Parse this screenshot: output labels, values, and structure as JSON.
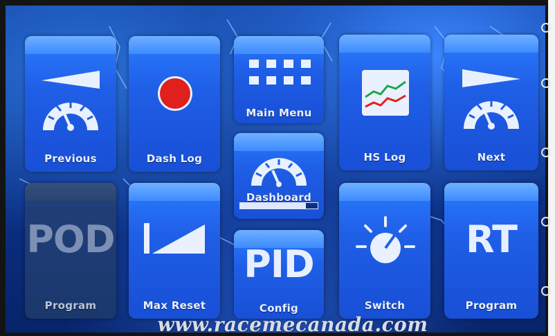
{
  "tiles": {
    "previous": {
      "label": "Previous"
    },
    "dash_log": {
      "label": "Dash Log"
    },
    "main_menu": {
      "label": "Main Menu"
    },
    "hs_log": {
      "label": "HS Log"
    },
    "next": {
      "label": "Next"
    },
    "pod_program": {
      "big": "POD",
      "label": "Program"
    },
    "max_reset": {
      "label": "Max Reset"
    },
    "dashboard": {
      "label": "Dashboard",
      "progress": 0.85
    },
    "pid_config": {
      "big": "PID",
      "label": "Config"
    },
    "switch": {
      "label": "Switch"
    },
    "rt_program": {
      "big": "RT",
      "label": "Program"
    }
  },
  "footer": {
    "url": "www.racemecanada.com"
  },
  "colors": {
    "tile": "#1f5ee6",
    "tile_cap": "#4a96ff",
    "record": "#e0201c",
    "background": "#0b2f83"
  }
}
